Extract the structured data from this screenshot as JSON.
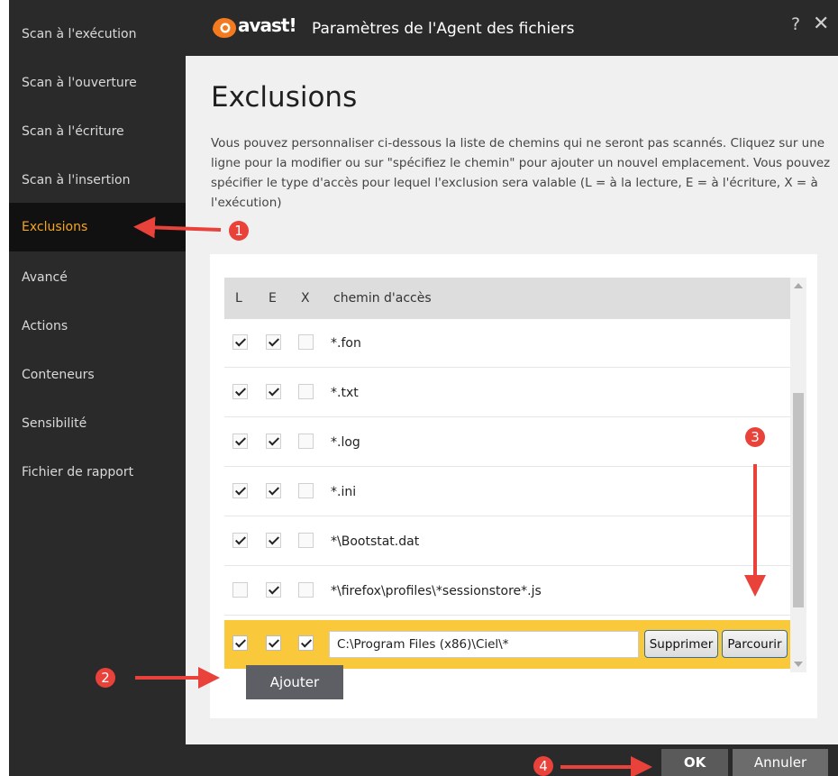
{
  "window": {
    "brand": "avast!",
    "title": "Paramètres de l'Agent des fichiers",
    "help": "?",
    "close": "✕"
  },
  "sidebar": {
    "items": [
      {
        "label": "Scan à l'exécution"
      },
      {
        "label": "Scan à l'ouverture"
      },
      {
        "label": "Scan à l'écriture"
      },
      {
        "label": "Scan à l'insertion"
      },
      {
        "label": "Exclusions",
        "active": true
      },
      {
        "label": "Avancé"
      },
      {
        "label": "Actions"
      },
      {
        "label": "Conteneurs"
      },
      {
        "label": "Sensibilité"
      },
      {
        "label": "Fichier de rapport"
      }
    ]
  },
  "main": {
    "title": "Exclusions",
    "description": "Vous pouvez personnaliser ci-dessous la liste de chemins qui ne seront pas scannés. Cliquez sur une ligne pour la modifier ou sur \"spécifiez le chemin\" pour ajouter un nouvel emplacement. Vous pouvez spécifier le type d'accès pour lequel l'exclusion sera valable (L = à la lecture, E = à l'écriture, X = à l'exécution)",
    "table": {
      "headers": {
        "l": "L",
        "e": "E",
        "x": "X",
        "path": "chemin d'accès"
      },
      "rows": [
        {
          "l": true,
          "e": true,
          "x": false,
          "path": "*.fon"
        },
        {
          "l": true,
          "e": true,
          "x": false,
          "path": "*.txt"
        },
        {
          "l": true,
          "e": true,
          "x": false,
          "path": "*.log"
        },
        {
          "l": true,
          "e": true,
          "x": false,
          "path": "*.ini"
        },
        {
          "l": true,
          "e": true,
          "x": false,
          "path": "*\\Bootstat.dat"
        },
        {
          "l": false,
          "e": true,
          "x": false,
          "path": "*\\firefox\\profiles\\*sessionstore*.js"
        }
      ],
      "edit_row": {
        "l": true,
        "e": true,
        "x": true,
        "path": "C:\\Program Files (x86)\\Ciel\\*",
        "delete_label": "Supprimer",
        "browse_label": "Parcourir"
      }
    },
    "add_label": "Ajouter"
  },
  "footer": {
    "ok_label": "OK",
    "cancel_label": "Annuler"
  },
  "annotations": {
    "badges": [
      "1",
      "2",
      "3",
      "4"
    ],
    "color": "#e8423a"
  },
  "colors": {
    "accent": "#f5a623",
    "highlight_row": "#f9c93b",
    "dark_bg": "#2a2a2a"
  }
}
